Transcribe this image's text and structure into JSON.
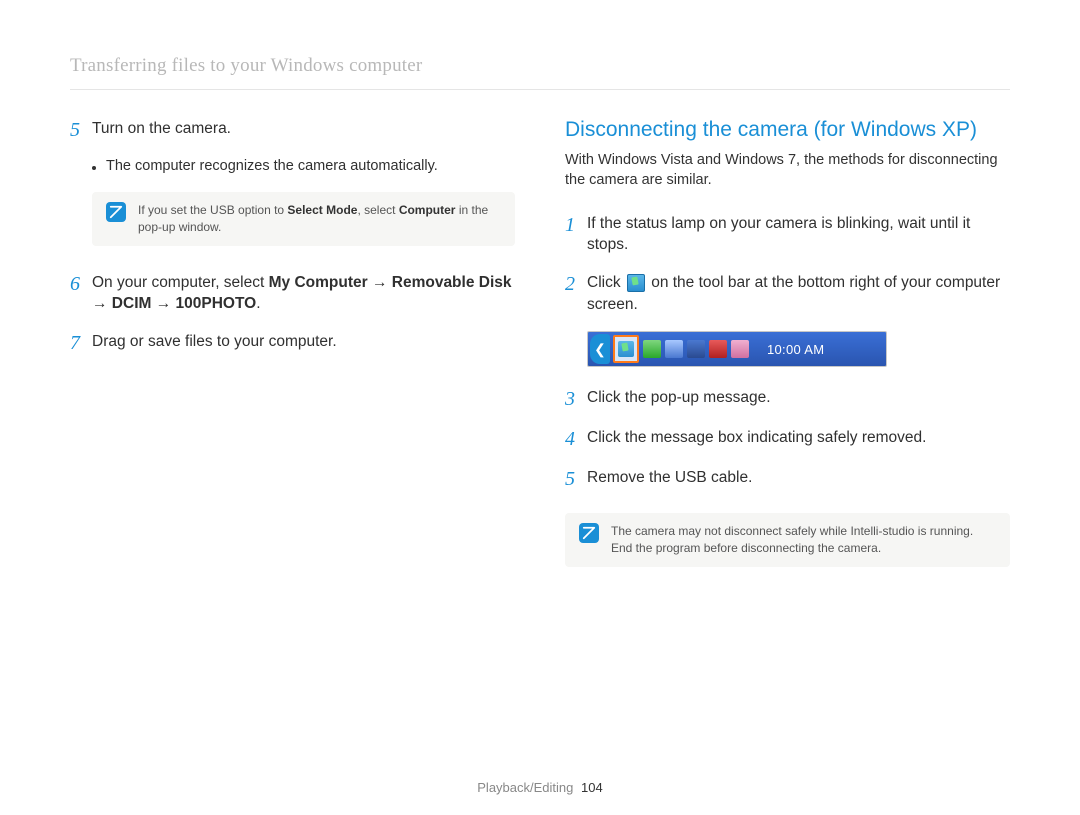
{
  "header": {
    "title": "Transferring files to your Windows computer"
  },
  "left": {
    "step5": {
      "num": "5",
      "text": "Turn on the camera.",
      "bullet": "The computer recognizes the camera automatically."
    },
    "note": {
      "pre": "If you set the USB option to ",
      "bold1": "Select Mode",
      "mid": ", select ",
      "bold2": "Computer",
      "post": " in the pop-up window."
    },
    "step6": {
      "num": "6",
      "pre": "On your computer, select ",
      "path": "My Computer → Removable Disk → DCIM → 100PHOTO",
      "post": "."
    },
    "step7": {
      "num": "7",
      "text": "Drag or save files to your computer."
    }
  },
  "right": {
    "heading": "Disconnecting the camera (for Windows XP)",
    "intro": "With Windows Vista and Windows 7, the methods for disconnecting the camera are similar.",
    "step1": {
      "num": "1",
      "text": "If the status lamp on your camera is blinking, wait until it stops."
    },
    "step2": {
      "num": "2",
      "pre": "Click ",
      "post": " on the tool bar at the bottom right of your computer screen."
    },
    "tray": {
      "time": "10:00 AM"
    },
    "step3": {
      "num": "3",
      "text": "Click the pop-up message."
    },
    "step4": {
      "num": "4",
      "text": "Click the message box indicating safely removed."
    },
    "step5": {
      "num": "5",
      "text": "Remove the USB cable."
    },
    "note": "The camera may not disconnect safely while Intelli-studio is running. End the program before disconnecting the camera."
  },
  "footer": {
    "section": "Playback/Editing",
    "page": "104"
  }
}
